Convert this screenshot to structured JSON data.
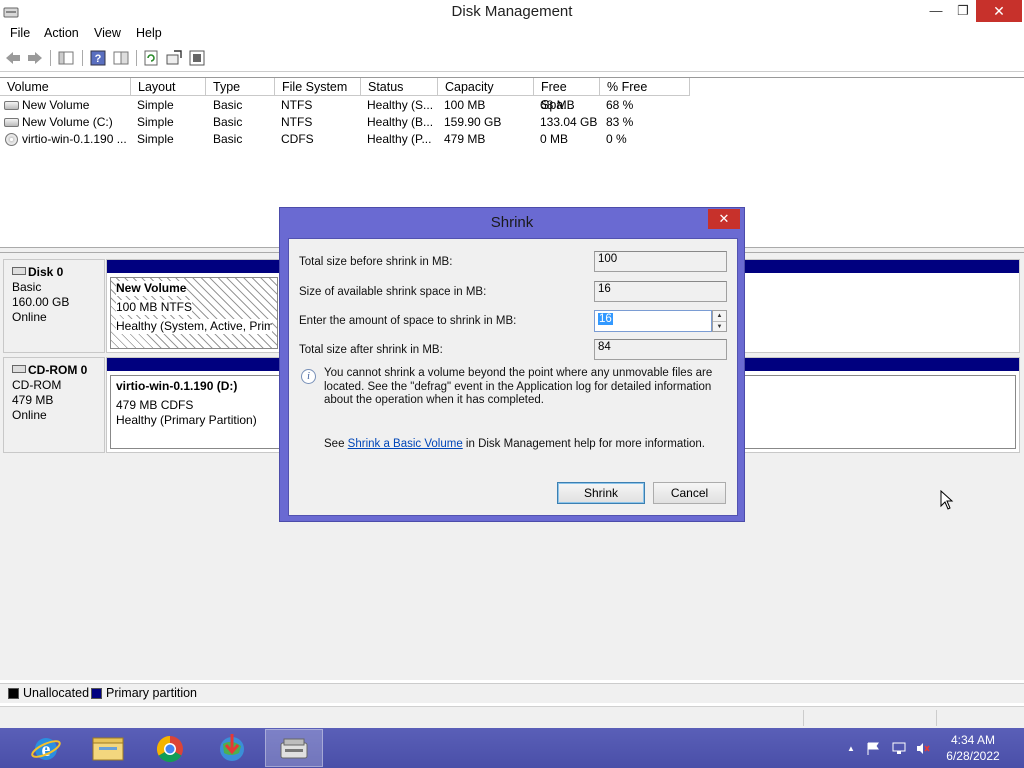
{
  "window": {
    "title": "Disk Management",
    "minimize": "—",
    "maximize": "❐",
    "close": "✕"
  },
  "menu": {
    "items": [
      "File",
      "Action",
      "View",
      "Help"
    ]
  },
  "volume_list": {
    "columns": [
      "Volume",
      "Layout",
      "Type",
      "File System",
      "Status",
      "Capacity",
      "Free Spa...",
      "% Free"
    ],
    "rows": [
      {
        "volume": "New Volume",
        "layout": "Simple",
        "type": "Basic",
        "fs": "NTFS",
        "status": "Healthy (S...",
        "capacity": "100 MB",
        "free": "68 MB",
        "pct": "68 %",
        "icon": "volume-icon"
      },
      {
        "volume": "New Volume (C:)",
        "layout": "Simple",
        "type": "Basic",
        "fs": "NTFS",
        "status": "Healthy (B...",
        "capacity": "159.90 GB",
        "free": "133.04 GB",
        "pct": "83 %",
        "icon": "volume-icon"
      },
      {
        "volume": "virtio-win-0.1.190 ...",
        "layout": "Simple",
        "type": "Basic",
        "fs": "CDFS",
        "status": "Healthy (P...",
        "capacity": "479 MB",
        "free": "0 MB",
        "pct": "0 %",
        "icon": "cdrom-icon"
      }
    ]
  },
  "disks": [
    {
      "name": "Disk 0",
      "kind": "Basic",
      "size": "160.00 GB",
      "state": "Online",
      "partition": {
        "name": "New Volume",
        "info": "100 MB NTFS",
        "status": "Healthy (System, Active, Primar"
      }
    },
    {
      "name": "CD-ROM 0",
      "kind": "CD-ROM",
      "size": "479 MB",
      "state": "Online",
      "partition": {
        "name": "virtio-win-0.1.190  (D:)",
        "info": "479 MB CDFS",
        "status": "Healthy (Primary Partition)"
      }
    }
  ],
  "legend": {
    "unallocated": "Unallocated",
    "primary": "Primary partition",
    "unallocated_color": "#000000",
    "primary_color": "#00007f"
  },
  "dialog": {
    "title": "Shrink",
    "close": "✕",
    "total_before_label": "Total size before shrink in MB:",
    "total_before_value": "100",
    "available_label": "Size of available shrink space in MB:",
    "available_value": "16",
    "amount_label": "Enter the amount of space to shrink in MB:",
    "amount_value": "16",
    "total_after_label": "Total size after shrink in MB:",
    "total_after_value": "84",
    "info_text": "You cannot shrink a volume beyond the point where any unmovable files are located. See the \"defrag\" event in the Application log for detailed information about the operation when it has completed.",
    "help_prefix": "See ",
    "help_link": "Shrink a Basic Volume",
    "help_suffix": " in Disk Management help for more information.",
    "shrink_button": "Shrink",
    "cancel_button": "Cancel"
  },
  "taskbar": {
    "time": "4:34 AM",
    "date": "6/28/2022",
    "accent": "#5055b0"
  }
}
